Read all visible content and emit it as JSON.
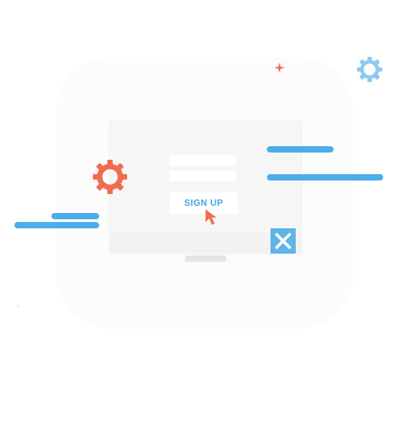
{
  "signup": {
    "label": "SIGN UP"
  },
  "colors": {
    "accent_blue": "#4aaee8",
    "accent_orange": "#f26b4f",
    "light_blue": "#8ec9f0"
  },
  "icons": {
    "gear_large": "gear-icon",
    "gear_small": "gear-icon",
    "sparkle": "sparkle-icon",
    "cursor": "cursor-arrow-icon",
    "close": "close-icon"
  }
}
